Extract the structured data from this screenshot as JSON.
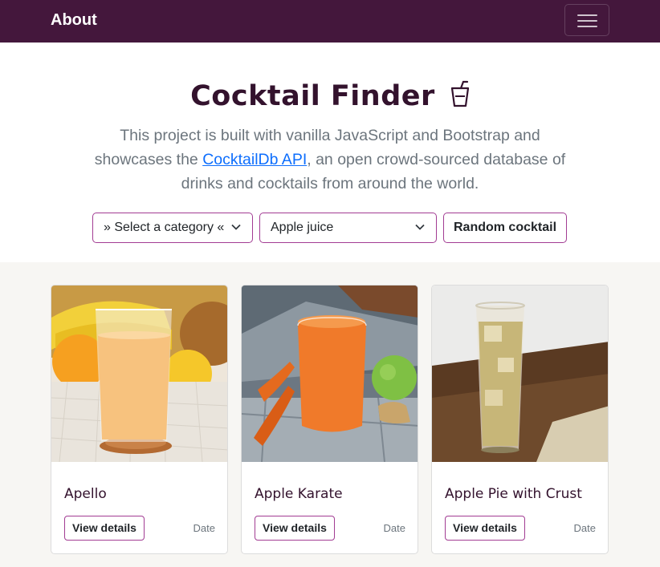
{
  "navbar": {
    "brand": "About",
    "menu_icon": "hamburger-icon"
  },
  "hero": {
    "title": "Cocktail Finder",
    "title_icon": "cup-icon",
    "description_before": "This project is built with vanilla JavaScript and Bootstrap and showcases the ",
    "description_link": "CocktailDb API",
    "description_after": ", an open crowd-sourced database of drinks and cocktails from around the world."
  },
  "controls": {
    "category_select": "» Select a category «",
    "ingredient_select": "Apple juice",
    "random_button": "Random cocktail"
  },
  "cards": [
    {
      "name": "Apello",
      "button": "View details",
      "date": "Date"
    },
    {
      "name": "Apple Karate",
      "button": "View details",
      "date": "Date"
    },
    {
      "name": "Apple Pie with Crust",
      "button": "View details",
      "date": "Date"
    }
  ],
  "colors": {
    "navbar": "#44173c",
    "accent_border": "#a23c93",
    "title": "#33122d",
    "link": "#0d6efd"
  }
}
